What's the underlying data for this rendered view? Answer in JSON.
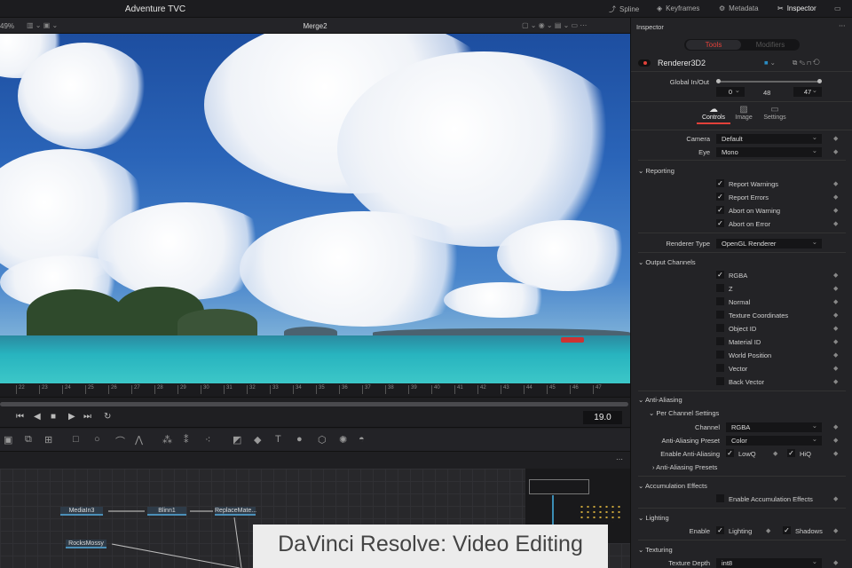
{
  "topbar": {
    "title": "Adventure TVC",
    "tabs": [
      {
        "label": "Spline",
        "icon": "spline-icon"
      },
      {
        "label": "Keyframes",
        "icon": "keyframes-icon"
      },
      {
        "label": "Metadata",
        "icon": "metadata-icon"
      },
      {
        "label": "Inspector",
        "icon": "inspector-icon"
      }
    ]
  },
  "viewer": {
    "zoom": "49%",
    "title": "Merge2"
  },
  "ruler": {
    "ticks": [
      "22",
      "23",
      "24",
      "25",
      "26",
      "27",
      "28",
      "29",
      "30",
      "31",
      "32",
      "33",
      "34",
      "35",
      "36",
      "37",
      "38",
      "39",
      "40",
      "41",
      "42",
      "43",
      "44",
      "45",
      "46",
      "47"
    ]
  },
  "transport": {
    "time": "19.0"
  },
  "nodes": [
    {
      "label": "MediaIn3"
    },
    {
      "label": "Blinn1"
    },
    {
      "label": "ReplaceMate..."
    },
    {
      "label": "RocksMossy"
    }
  ],
  "caption": "DaVinci Resolve: Video Editing",
  "inspector": {
    "header": "Inspector",
    "tabs": [
      "Tools",
      "Modifiers"
    ],
    "tool_name": "Renderer3D2",
    "global_label": "Global In/Out",
    "global_in": "0",
    "global_mid": "48",
    "global_out": "47",
    "subtabs": [
      "Controls",
      "Image",
      "Settings"
    ],
    "camera_label": "Camera",
    "camera": "Default",
    "eye_label": "Eye",
    "eye": "Mono",
    "reporting": "Reporting",
    "report_items": [
      {
        "label": "Report Warnings",
        "checked": true
      },
      {
        "label": "Report Errors",
        "checked": true
      },
      {
        "label": "Abort on Warning",
        "checked": true
      },
      {
        "label": "Abort on Error",
        "checked": true
      }
    ],
    "renderer_type_label": "Renderer Type",
    "renderer_type": "OpenGL Renderer",
    "output_channels": "Output Channels",
    "channels": [
      {
        "label": "RGBA",
        "checked": true
      },
      {
        "label": "Z",
        "checked": false
      },
      {
        "label": "Normal",
        "checked": false
      },
      {
        "label": "Texture Coordinates",
        "checked": false
      },
      {
        "label": "Object ID",
        "checked": false
      },
      {
        "label": "Material ID",
        "checked": false
      },
      {
        "label": "World Position",
        "checked": false
      },
      {
        "label": "Vector",
        "checked": false
      },
      {
        "label": "Back Vector",
        "checked": false
      }
    ],
    "anti_aliasing": "Anti-Aliasing",
    "per_channel": "Per Channel Settings",
    "channel_label": "Channel",
    "channel": "RGBA",
    "aa_preset_label": "Anti-Aliasing Preset",
    "aa_preset": "Color",
    "enable_aa_label": "Enable Anti-Aliasing",
    "lowq": "LowQ",
    "hiq": "HiQ",
    "aa_presets": "Anti-Aliasing Presets",
    "accumulation": "Accumulation Effects",
    "enable_accum": "Enable Accumulation Effects",
    "lighting": "Lighting",
    "enable_label": "Enable",
    "lighting_cb": "Lighting",
    "shadows_cb": "Shadows",
    "texturing": "Texturing",
    "texture_depth_label": "Texture Depth",
    "texture_depth": "int8"
  },
  "colors": {
    "accent": "#e2413a",
    "bg": "#232326"
  }
}
